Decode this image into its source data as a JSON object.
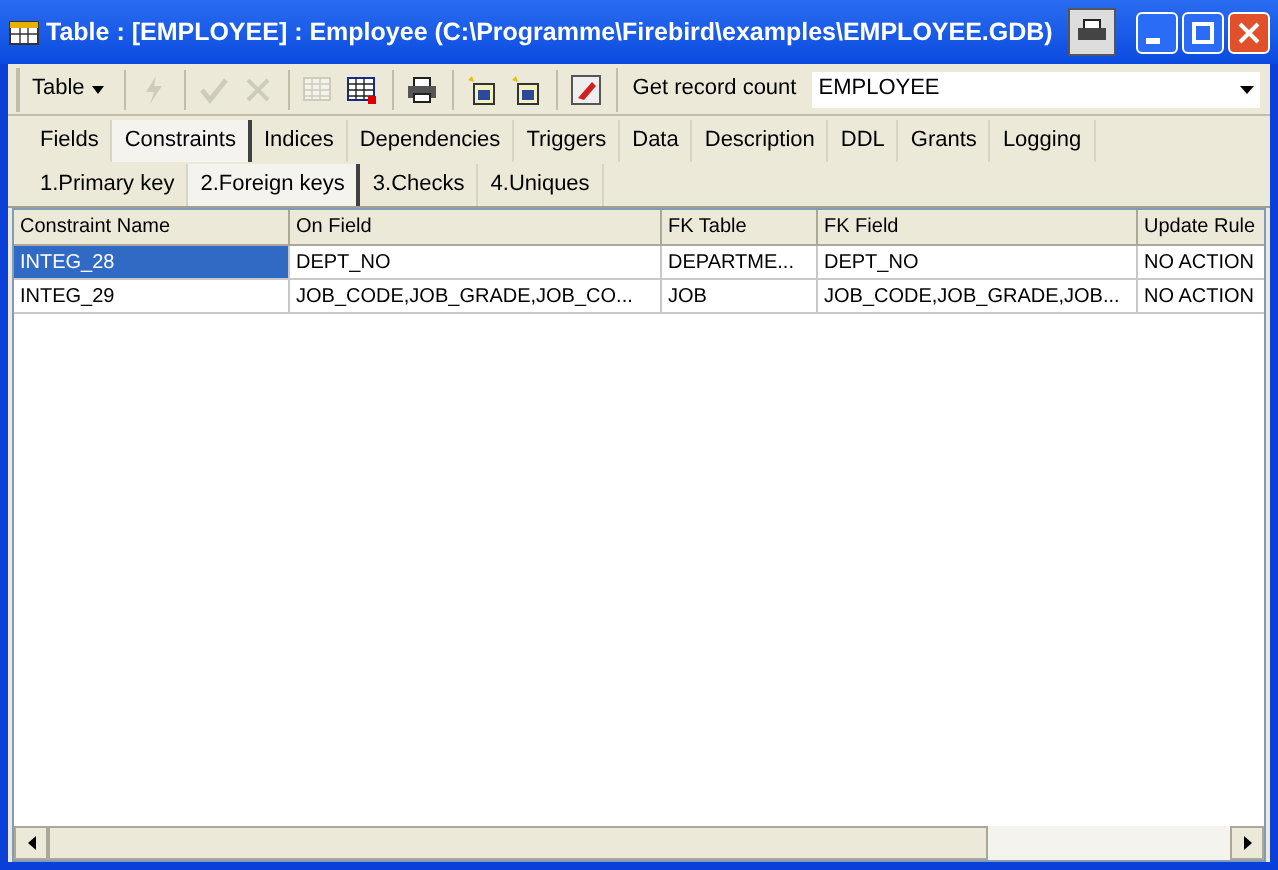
{
  "window": {
    "title": "Table : [EMPLOYEE] : Employee (C:\\Programme\\Firebird\\examples\\EMPLOYEE.GDB)"
  },
  "toolbar": {
    "menu_button": "Table",
    "icons": [
      {
        "kind": "lightning",
        "disabled": true
      },
      {
        "kind": "check",
        "disabled": true
      },
      {
        "kind": "cross",
        "disabled": true
      },
      {
        "kind": "grid",
        "disabled": true
      },
      {
        "kind": "grid",
        "disabled": false
      },
      {
        "kind": "printer",
        "disabled": false
      },
      {
        "kind": "wizard",
        "disabled": false
      },
      {
        "kind": "wizard",
        "disabled": false
      },
      {
        "kind": "eraser",
        "disabled": false
      }
    ],
    "count_button": "Get record count",
    "combo_value": "EMPLOYEE"
  },
  "tabs": [
    {
      "label": "Fields",
      "selected": false
    },
    {
      "label": "Constraints",
      "selected": true
    },
    {
      "label": "Indices",
      "selected": false
    },
    {
      "label": "Dependencies",
      "selected": false
    },
    {
      "label": "Triggers",
      "selected": false
    },
    {
      "label": "Data",
      "selected": false
    },
    {
      "label": "Description",
      "selected": false
    },
    {
      "label": "DDL",
      "selected": false
    },
    {
      "label": "Grants",
      "selected": false
    },
    {
      "label": "Logging",
      "selected": false
    }
  ],
  "subtabs": [
    {
      "label": "1.Primary key",
      "selected": false
    },
    {
      "label": "2.Foreign keys",
      "selected": true
    },
    {
      "label": "3.Checks",
      "selected": false
    },
    {
      "label": "4.Uniques",
      "selected": false
    }
  ],
  "table": {
    "columns": [
      "Constraint Name",
      "On Field",
      "FK Table",
      "FK Field",
      "Update Rule"
    ],
    "rows": [
      {
        "selected": true,
        "cells": [
          "INTEG_28",
          "DEPT_NO",
          "DEPARTME...",
          "DEPT_NO",
          "NO ACTION"
        ]
      },
      {
        "selected": false,
        "cells": [
          "INTEG_29",
          "JOB_CODE,JOB_GRADE,JOB_CO...",
          "JOB",
          "JOB_CODE,JOB_GRADE,JOB...",
          "NO ACTION"
        ]
      }
    ]
  }
}
